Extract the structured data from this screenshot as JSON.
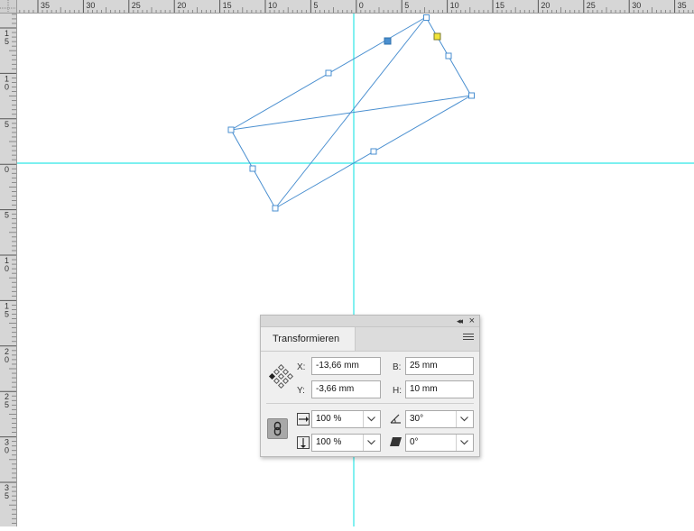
{
  "ruler": {
    "top_labels": [
      "35",
      "30",
      "25",
      "20",
      "15",
      "10",
      "5",
      "0",
      "5",
      "10",
      "15",
      "20",
      "25",
      "30",
      "35"
    ],
    "left_labels": [
      "1 5",
      "1 0",
      "5",
      "0",
      "5",
      "1 0",
      "1 5",
      "2 0",
      "2 5",
      "3 0",
      "3 5"
    ]
  },
  "colors": {
    "guide": "#2ee6e6",
    "path": "#4a8fd0",
    "anchor_selected": "#4a8fd0",
    "anchor_reference": "#f0e43a"
  },
  "panel": {
    "collapse_icon": "double-chevron-left-icon",
    "close_icon": "close-icon",
    "tab_label": "Transformieren",
    "menu_icon": "panel-menu-icon",
    "reference_point_icon": "reference-point-grid-icon",
    "x_label": "X:",
    "x_value": "-13,66 mm",
    "y_label": "Y:",
    "y_value": "-3,66 mm",
    "w_label": "B:",
    "w_value": "25 mm",
    "h_label": "H:",
    "h_value": "10 mm",
    "constrain_icon": "chain-link-icon",
    "scale_x_icon": "scale-horizontal-icon",
    "scale_x_value": "100 %",
    "scale_y_icon": "scale-vertical-icon",
    "scale_y_value": "100 %",
    "rotate_icon": "rotate-angle-icon",
    "rotate_value": "30°",
    "shear_icon": "shear-icon",
    "shear_value": "0°"
  }
}
